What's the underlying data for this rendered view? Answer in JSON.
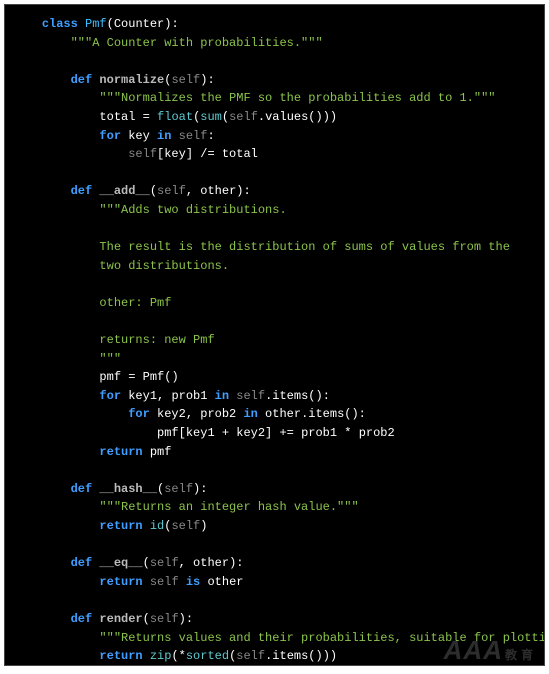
{
  "code": {
    "lines": [
      {
        "i": 1,
        "s": [
          {
            "c": "kw",
            "t": "class"
          },
          {
            "c": "pn",
            "t": " "
          },
          {
            "c": "cls",
            "t": "Pmf"
          },
          {
            "c": "pn",
            "t": "(Counter):"
          }
        ]
      },
      {
        "i": 2,
        "s": [
          {
            "c": "str",
            "t": "\"\"\"A Counter with probabilities.\"\"\""
          }
        ]
      },
      {
        "i": 0,
        "s": []
      },
      {
        "i": 2,
        "s": [
          {
            "c": "kw",
            "t": "def"
          },
          {
            "c": "pn",
            "t": " "
          },
          {
            "c": "fn",
            "t": "normalize"
          },
          {
            "c": "pn",
            "t": "("
          },
          {
            "c": "prm",
            "t": "self"
          },
          {
            "c": "pn",
            "t": "):"
          }
        ]
      },
      {
        "i": 3,
        "s": [
          {
            "c": "str",
            "t": "\"\"\"Normalizes the PMF so the probabilities add to 1.\"\"\""
          }
        ]
      },
      {
        "i": 3,
        "s": [
          {
            "c": "id",
            "t": "total "
          },
          {
            "c": "op",
            "t": "="
          },
          {
            "c": "id",
            "t": " "
          },
          {
            "c": "bi",
            "t": "float"
          },
          {
            "c": "pn",
            "t": "("
          },
          {
            "c": "bi",
            "t": "sum"
          },
          {
            "c": "pn",
            "t": "("
          },
          {
            "c": "prm",
            "t": "self"
          },
          {
            "c": "pn",
            "t": ".values()))"
          }
        ]
      },
      {
        "i": 3,
        "s": [
          {
            "c": "kw",
            "t": "for"
          },
          {
            "c": "id",
            "t": " key "
          },
          {
            "c": "kw",
            "t": "in"
          },
          {
            "c": "id",
            "t": " "
          },
          {
            "c": "prm",
            "t": "self"
          },
          {
            "c": "pn",
            "t": ":"
          }
        ]
      },
      {
        "i": 4,
        "s": [
          {
            "c": "prm",
            "t": "self"
          },
          {
            "c": "pn",
            "t": "[key] "
          },
          {
            "c": "op",
            "t": "/="
          },
          {
            "c": "id",
            "t": " total"
          }
        ]
      },
      {
        "i": 0,
        "s": []
      },
      {
        "i": 2,
        "s": [
          {
            "c": "kw",
            "t": "def"
          },
          {
            "c": "pn",
            "t": " "
          },
          {
            "c": "fn",
            "t": "__add__"
          },
          {
            "c": "pn",
            "t": "("
          },
          {
            "c": "prm",
            "t": "self"
          },
          {
            "c": "pn",
            "t": ", other):"
          }
        ]
      },
      {
        "i": 3,
        "s": [
          {
            "c": "str",
            "t": "\"\"\"Adds two distributions."
          }
        ]
      },
      {
        "i": 0,
        "s": []
      },
      {
        "i": 3,
        "s": [
          {
            "c": "str",
            "t": "The result is the distribution of sums of values from the"
          }
        ]
      },
      {
        "i": 3,
        "s": [
          {
            "c": "str",
            "t": "two distributions."
          }
        ]
      },
      {
        "i": 0,
        "s": []
      },
      {
        "i": 3,
        "s": [
          {
            "c": "str",
            "t": "other: Pmf"
          }
        ]
      },
      {
        "i": 0,
        "s": []
      },
      {
        "i": 3,
        "s": [
          {
            "c": "str",
            "t": "returns: new Pmf"
          }
        ]
      },
      {
        "i": 3,
        "s": [
          {
            "c": "str",
            "t": "\"\"\""
          }
        ]
      },
      {
        "i": 3,
        "s": [
          {
            "c": "id",
            "t": "pmf "
          },
          {
            "c": "op",
            "t": "="
          },
          {
            "c": "id",
            "t": " Pmf()"
          }
        ]
      },
      {
        "i": 3,
        "s": [
          {
            "c": "kw",
            "t": "for"
          },
          {
            "c": "id",
            "t": " key1, prob1 "
          },
          {
            "c": "kw",
            "t": "in"
          },
          {
            "c": "id",
            "t": " "
          },
          {
            "c": "prm",
            "t": "self"
          },
          {
            "c": "pn",
            "t": ".items():"
          }
        ]
      },
      {
        "i": 4,
        "s": [
          {
            "c": "kw",
            "t": "for"
          },
          {
            "c": "id",
            "t": " key2, prob2 "
          },
          {
            "c": "kw",
            "t": "in"
          },
          {
            "c": "id",
            "t": " other.items():"
          }
        ]
      },
      {
        "i": 5,
        "s": [
          {
            "c": "id",
            "t": "pmf[key1 "
          },
          {
            "c": "op",
            "t": "+"
          },
          {
            "c": "id",
            "t": " key2] "
          },
          {
            "c": "op",
            "t": "+="
          },
          {
            "c": "id",
            "t": " prob1 "
          },
          {
            "c": "op",
            "t": "*"
          },
          {
            "c": "id",
            "t": " prob2"
          }
        ]
      },
      {
        "i": 3,
        "s": [
          {
            "c": "kw",
            "t": "return"
          },
          {
            "c": "id",
            "t": " pmf"
          }
        ]
      },
      {
        "i": 0,
        "s": []
      },
      {
        "i": 2,
        "s": [
          {
            "c": "kw",
            "t": "def"
          },
          {
            "c": "pn",
            "t": " "
          },
          {
            "c": "fn",
            "t": "__hash__"
          },
          {
            "c": "pn",
            "t": "("
          },
          {
            "c": "prm",
            "t": "self"
          },
          {
            "c": "pn",
            "t": "):"
          }
        ]
      },
      {
        "i": 3,
        "s": [
          {
            "c": "str",
            "t": "\"\"\"Returns an integer hash value.\"\"\""
          }
        ]
      },
      {
        "i": 3,
        "s": [
          {
            "c": "kw",
            "t": "return"
          },
          {
            "c": "id",
            "t": " "
          },
          {
            "c": "bi",
            "t": "id"
          },
          {
            "c": "pn",
            "t": "("
          },
          {
            "c": "prm",
            "t": "self"
          },
          {
            "c": "pn",
            "t": ")"
          }
        ]
      },
      {
        "i": 0,
        "s": []
      },
      {
        "i": 2,
        "s": [
          {
            "c": "kw",
            "t": "def"
          },
          {
            "c": "pn",
            "t": " "
          },
          {
            "c": "fn",
            "t": "__eq__"
          },
          {
            "c": "pn",
            "t": "("
          },
          {
            "c": "prm",
            "t": "self"
          },
          {
            "c": "pn",
            "t": ", other):"
          }
        ]
      },
      {
        "i": 3,
        "s": [
          {
            "c": "kw",
            "t": "return"
          },
          {
            "c": "id",
            "t": " "
          },
          {
            "c": "prm",
            "t": "self"
          },
          {
            "c": "id",
            "t": " "
          },
          {
            "c": "kw",
            "t": "is"
          },
          {
            "c": "id",
            "t": " other"
          }
        ]
      },
      {
        "i": 0,
        "s": []
      },
      {
        "i": 2,
        "s": [
          {
            "c": "kw",
            "t": "def"
          },
          {
            "c": "pn",
            "t": " "
          },
          {
            "c": "fn",
            "t": "render"
          },
          {
            "c": "pn",
            "t": "("
          },
          {
            "c": "prm",
            "t": "self"
          },
          {
            "c": "pn",
            "t": "):"
          }
        ]
      },
      {
        "i": 3,
        "s": [
          {
            "c": "str",
            "t": "\"\"\"Returns values and their probabilities, suitable for plotting.\"\"\""
          }
        ]
      },
      {
        "i": 3,
        "s": [
          {
            "c": "kw",
            "t": "return"
          },
          {
            "c": "id",
            "t": " "
          },
          {
            "c": "bi",
            "t": "zip"
          },
          {
            "c": "pn",
            "t": "("
          },
          {
            "c": "op",
            "t": "*"
          },
          {
            "c": "bi",
            "t": "sorted"
          },
          {
            "c": "pn",
            "t": "("
          },
          {
            "c": "prm",
            "t": "self"
          },
          {
            "c": "pn",
            "t": ".items()))"
          }
        ]
      }
    ]
  },
  "watermark": {
    "main": "AAA",
    "sub": "教育"
  }
}
